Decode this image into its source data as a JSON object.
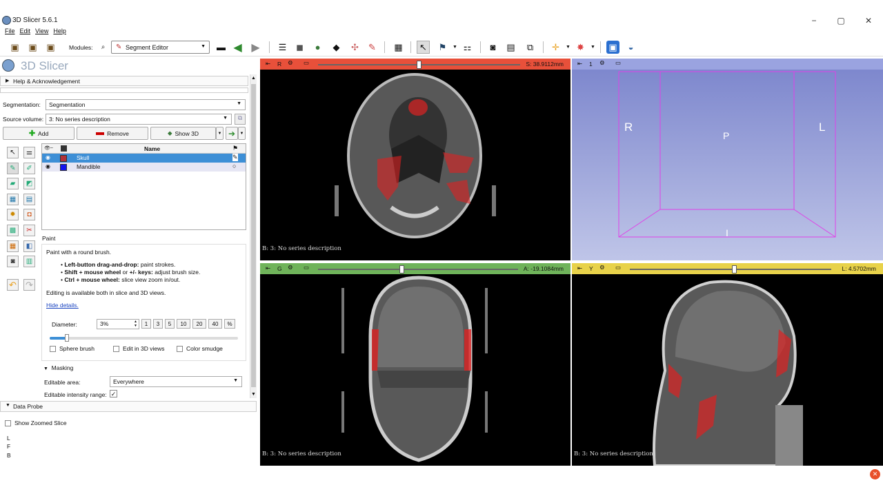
{
  "window": {
    "title": "3D Slicer 5.6.1",
    "min": "−",
    "max": "▢",
    "close": "✕"
  },
  "menu": [
    "File",
    "Edit",
    "View",
    "Help"
  ],
  "toolbar": {
    "modules_label": "Modules:",
    "module_selected": "Segment Editor"
  },
  "brand": "3D Slicer",
  "help_section": "Help & Acknowledgement",
  "segmentation": {
    "label": "Segmentation:",
    "value": "Segmentation"
  },
  "source_volume": {
    "label": "Source volume:",
    "value": "3: No series description"
  },
  "buttons": {
    "add": "Add",
    "remove": "Remove",
    "show3d": "Show 3D"
  },
  "table": {
    "header_name": "Name",
    "rows": [
      {
        "name": "Skull",
        "color": "#b0323a",
        "selected": true
      },
      {
        "name": "Mandible",
        "color": "#1414ee",
        "selected": false
      }
    ]
  },
  "paint": {
    "title": "Paint",
    "desc": "Paint with a round brush.",
    "tips": [
      {
        "bold": "Left-button drag-and-drop:",
        "text": " paint strokes."
      },
      {
        "bold": "Shift + mouse wheel",
        "text": " or ",
        "bold2": "+/- keys:",
        "text2": " adjust brush size."
      },
      {
        "bold": "Ctrl + mouse wheel:",
        "text": " slice view zoom in/out."
      }
    ],
    "editing_note": "Editing is available both in slice and 3D views.",
    "hide_details": "Hide details.",
    "diameter_label": "Diameter:",
    "diameter_value": "3%",
    "presets": [
      "1",
      "3",
      "5",
      "10",
      "20",
      "40",
      "%"
    ],
    "diameter_slider_fraction": 0.09,
    "sphere_brush": "Sphere brush",
    "edit_3d": "Edit in 3D views",
    "color_smudge": "Color smudge"
  },
  "masking": {
    "title": "Masking",
    "editable_area_label": "Editable area:",
    "editable_area": "Everywhere",
    "intensity_label": "Editable intensity range:",
    "intensity_checked": "✓"
  },
  "data_probe": {
    "title": "Data Probe",
    "zoom_label": "Show Zoomed Slice",
    "coords": [
      "L",
      "F",
      "B"
    ]
  },
  "views": {
    "red": {
      "letter": "R",
      "value": "S: 38.9112mm",
      "slider": 0.5,
      "bar_color": "#e8503a",
      "caption": "B: 3: No series description"
    },
    "green": {
      "letter": "G",
      "value": "A: -19.1084mm",
      "slider": 0.42,
      "bar_color": "#6fb35a",
      "caption": "B: 3: No series description"
    },
    "yellow": {
      "letter": "Y",
      "value": "L: 4.5702mm",
      "slider": 0.52,
      "bar_color": "#e8d24a",
      "caption": "B: 3: No series description"
    },
    "threeD": {
      "number": "1",
      "labels": {
        "R": "R",
        "P": "P",
        "L": "L",
        "I": "I"
      }
    }
  }
}
